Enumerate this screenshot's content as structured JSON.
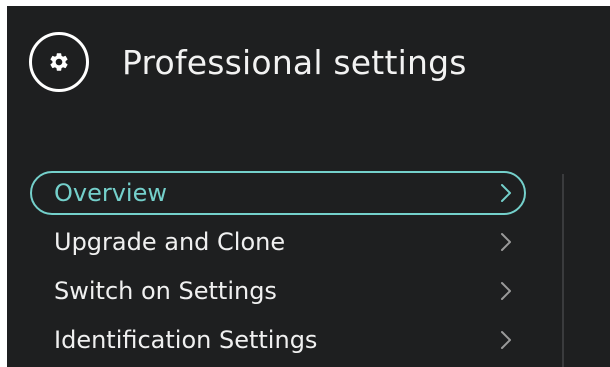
{
  "header": {
    "title": "Professional settings",
    "icon": "gear-icon"
  },
  "menu": {
    "items": [
      {
        "label": "Overview",
        "selected": true
      },
      {
        "label": "Upgrade and Clone",
        "selected": false
      },
      {
        "label": "Switch on Settings",
        "selected": false
      },
      {
        "label": "Identification Settings",
        "selected": false
      }
    ]
  },
  "colors": {
    "background": "#1e1f20",
    "text": "#f0f0f0",
    "accent": "#74d0cb",
    "chevron": "#9a9a9a",
    "divider": "#3a3b3d"
  }
}
